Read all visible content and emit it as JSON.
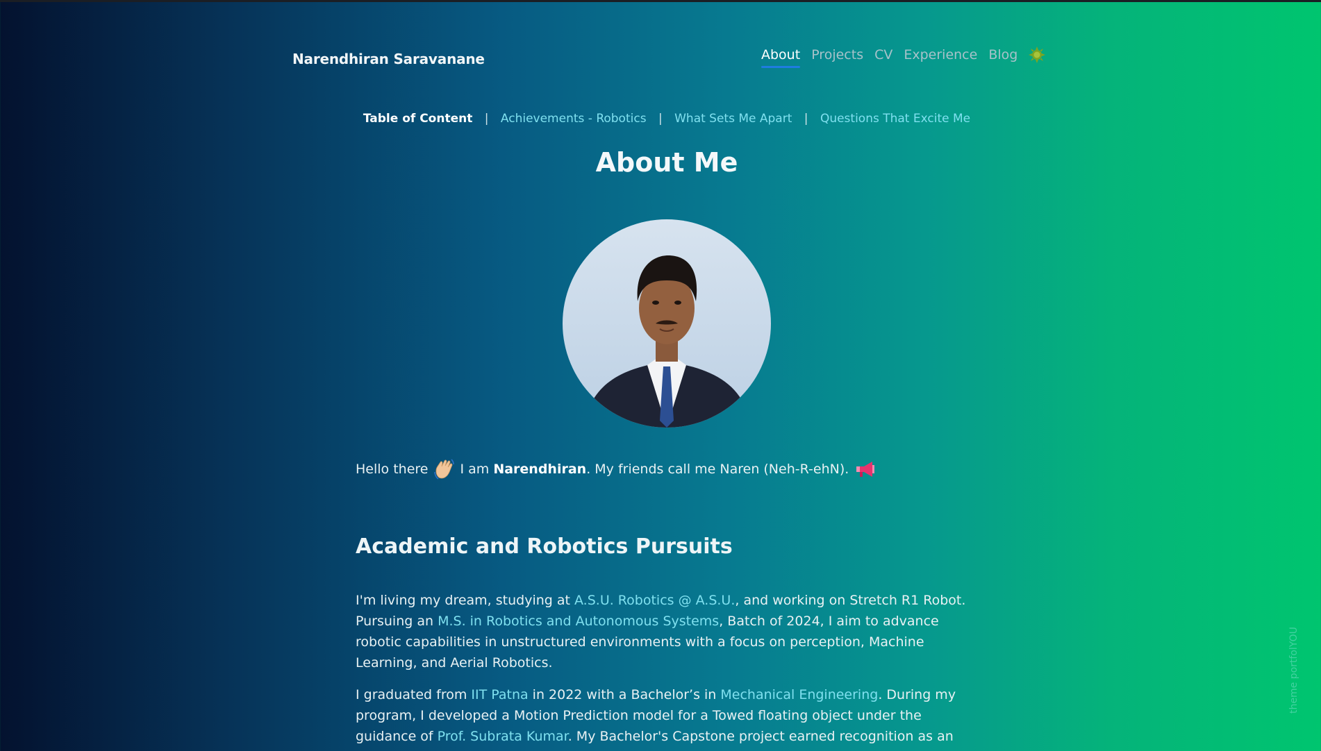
{
  "header": {
    "brand": "Narendhiran Saravanane",
    "nav": [
      "About",
      "Projects",
      "CV",
      "Experience",
      "Blog"
    ],
    "active_nav": "About",
    "theme_toggle_icon": "sun-icon"
  },
  "toc": {
    "title": "Table of Content",
    "links": [
      "Achievements - Robotics",
      "What Sets Me Apart",
      "Questions That Excite Me"
    ]
  },
  "page": {
    "title": "About Me",
    "avatar_icon": "profile-photo"
  },
  "greeting": {
    "before": "Hello there",
    "wave_icon": "waving-hand-emoji",
    "i_am": "I am",
    "name": "Narendhiran",
    "after": ". My friends call me Naren (Neh-R-ehN).",
    "megaphone_icon": "megaphone-emoji"
  },
  "section": {
    "heading": "Academic and Robotics Pursuits"
  },
  "para1": {
    "t1": "I'm living my dream, studying at ",
    "link1": "A.S.U. Robotics @ A.S.U.",
    "t2": ", and working on Stretch R1 Robot. Pursuing an ",
    "link2": "M.S. in Robotics and Autonomous Systems",
    "t3": ", Batch of 2024, I aim to advance robotic capabilities in unstructured environments with a focus on perception, Machine Learning, and Aerial Robotics."
  },
  "para2": {
    "t1": "I graduated from ",
    "link1": "IIT Patna",
    "t2": " in 2022 with a Bachelor’s in ",
    "link2": "Mechanical Engineering",
    "t3": ". During my program, I developed a Motion Prediction model for a Towed floating object under the guidance of ",
    "link3": "Prof. Subrata Kumar",
    "t4": ". My Bachelor's Capstone project earned recognition as an Undergraduate Project"
  },
  "footer": {
    "credit": "theme portfolYOU"
  },
  "colors": {
    "gradient_start": "#04122f",
    "gradient_end": "#00c56f",
    "link": "#7fe0ef",
    "nav_active_underline": "#1f7ce0"
  }
}
